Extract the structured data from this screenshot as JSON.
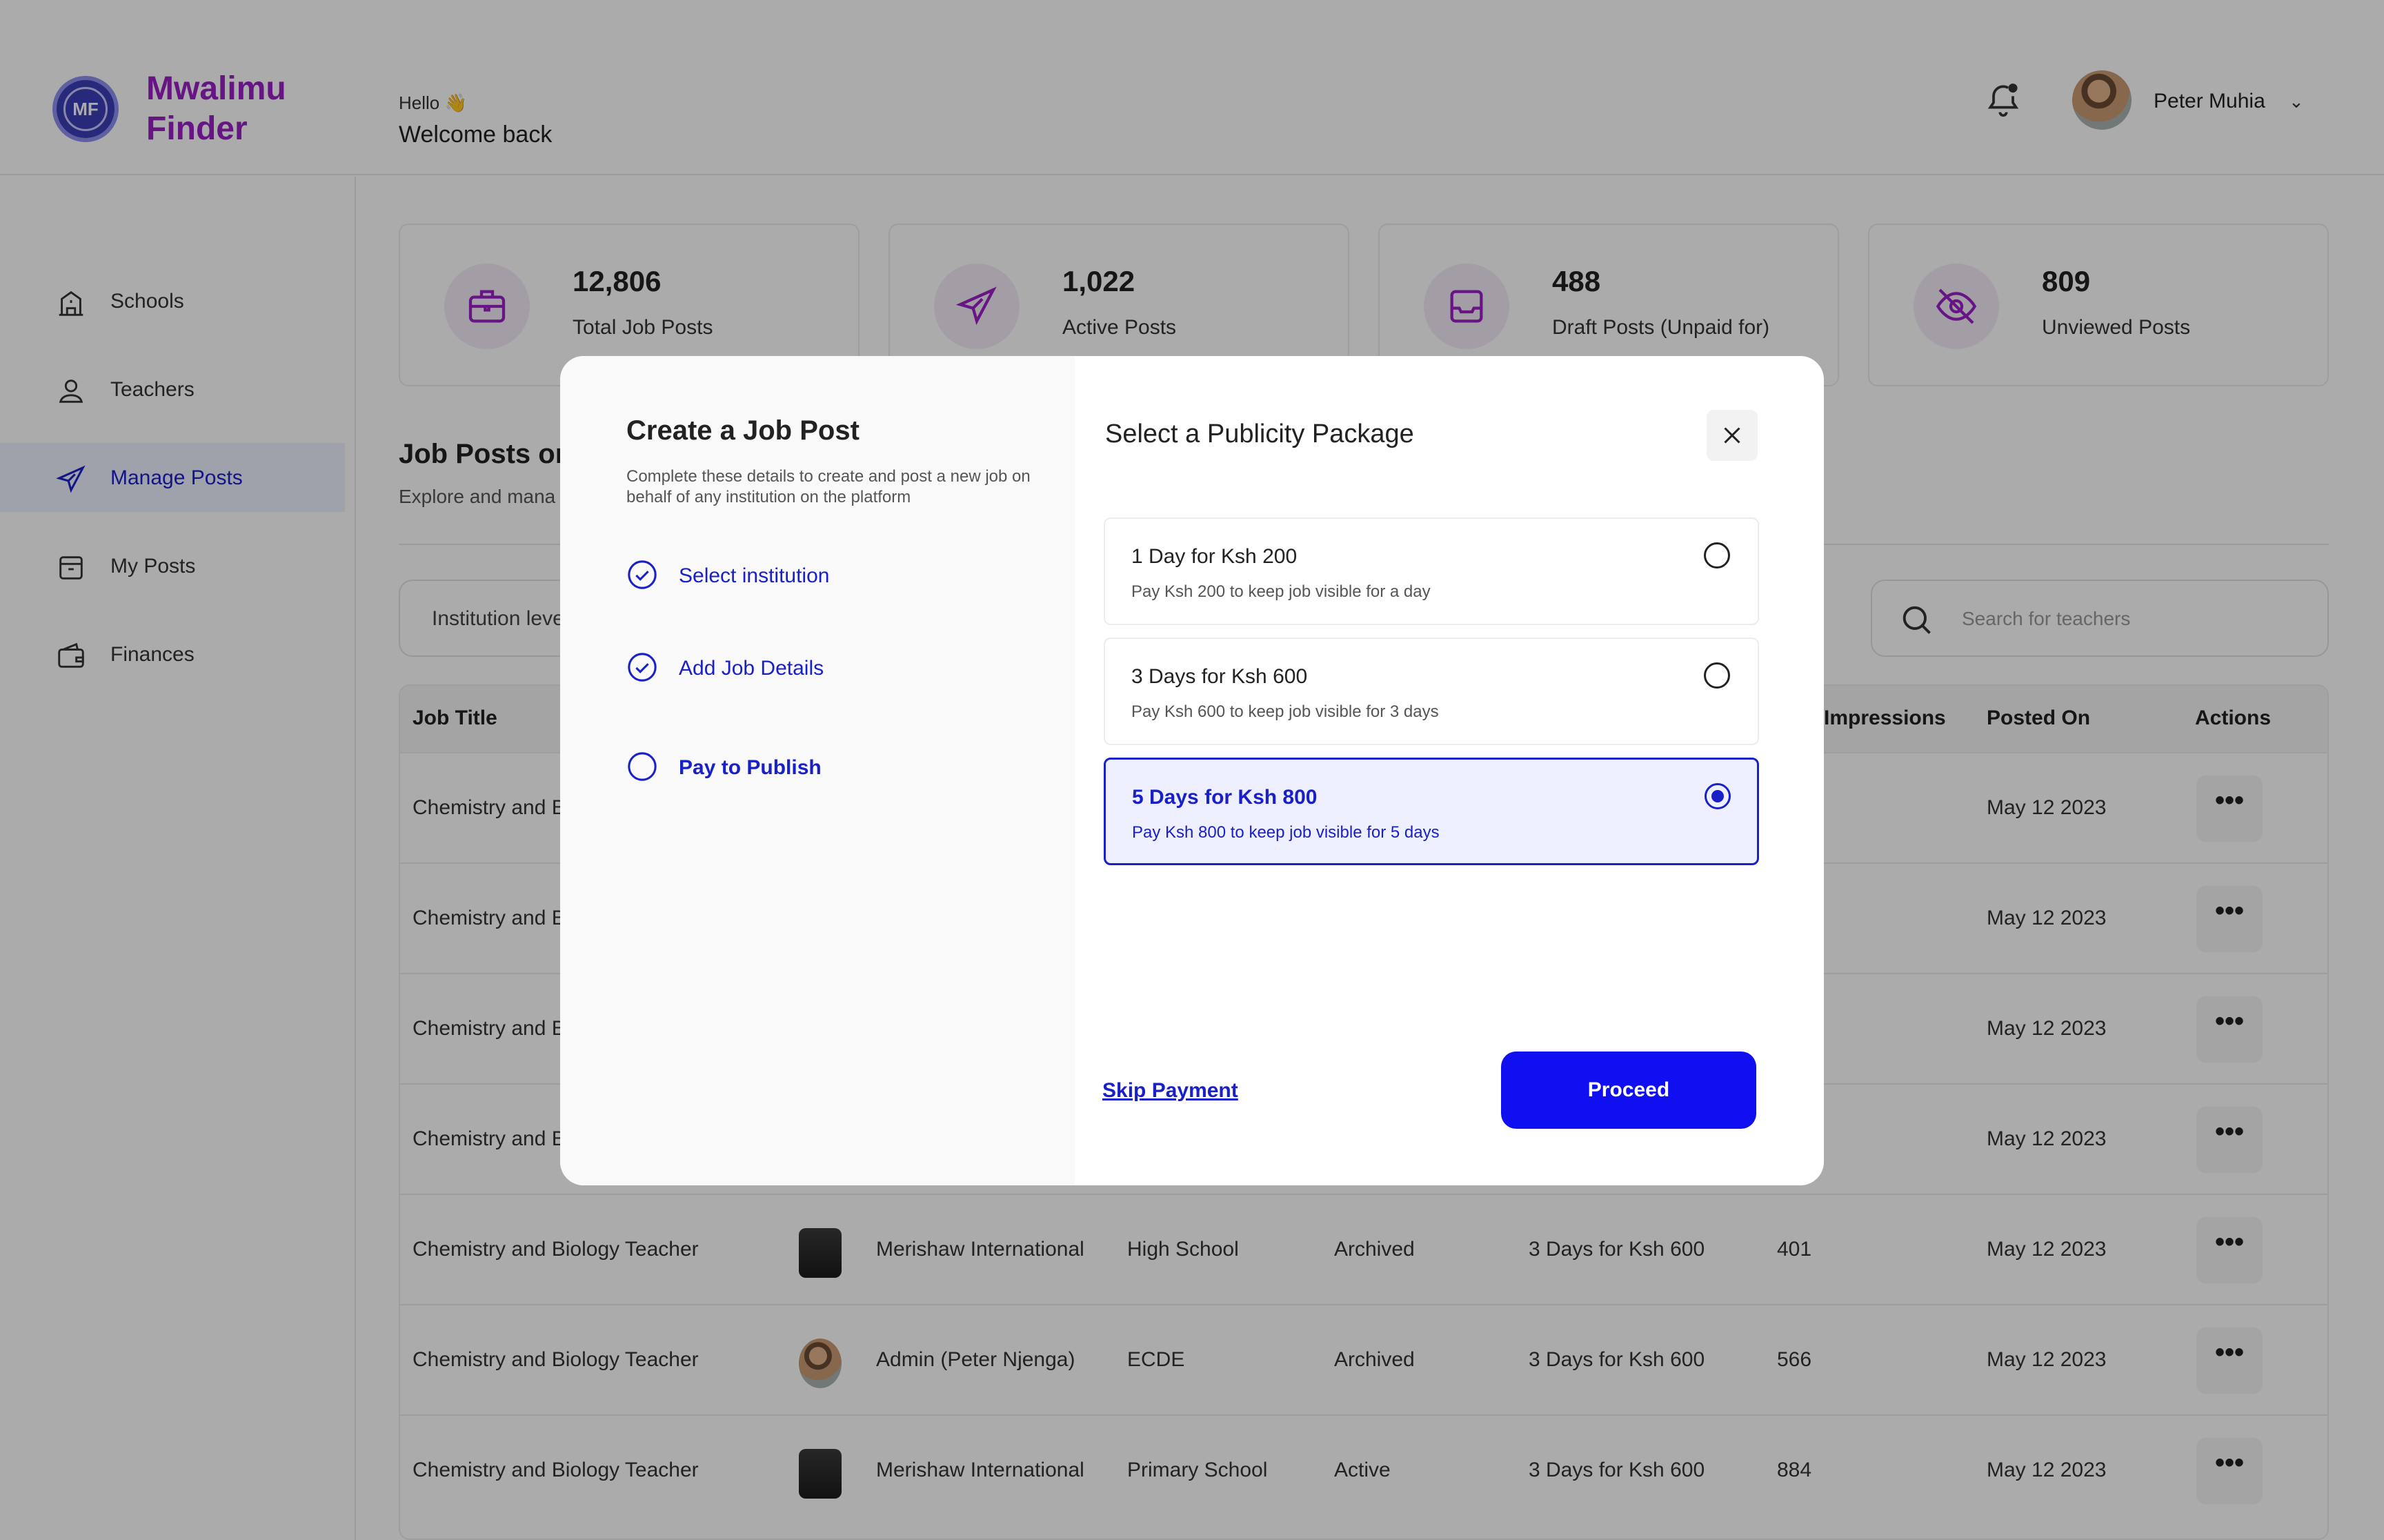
{
  "brand": {
    "name": "Mwalimu Finder",
    "logo_text": "MF"
  },
  "header": {
    "hello": "Hello 👋",
    "welcome": "Welcome back",
    "user_name": "Peter Muhia"
  },
  "sidebar": {
    "items": [
      {
        "label": "Schools",
        "icon": "school-icon"
      },
      {
        "label": "Teachers",
        "icon": "user-icon"
      },
      {
        "label": "Manage Posts",
        "icon": "send-icon",
        "active": true
      },
      {
        "label": "My Posts",
        "icon": "archive-box-icon"
      },
      {
        "label": "Finances",
        "icon": "wallet-icon"
      }
    ]
  },
  "stats": [
    {
      "value": "12,806",
      "label": "Total Job Posts",
      "icon": "briefcase-icon"
    },
    {
      "value": "1,022",
      "label": "Active Posts",
      "icon": "send-icon"
    },
    {
      "value": "488",
      "label": "Draft Posts (Unpaid for)",
      "icon": "inbox-icon"
    },
    {
      "value": "809",
      "label": "Unviewed Posts",
      "icon": "eye-off-icon"
    }
  ],
  "section": {
    "title": "Job Posts on",
    "subtitle": "Explore and mana"
  },
  "filter": {
    "label": "Institution leve"
  },
  "search": {
    "placeholder": "Search for teachers"
  },
  "table": {
    "columns": [
      "Job Title",
      "Impressions",
      "Posted On",
      "Actions"
    ],
    "rows": [
      {
        "title": "Chemistry and B",
        "institution": "",
        "level": "",
        "status": "",
        "package": "",
        "impressions": "",
        "posted": "May 12 2023"
      },
      {
        "title": "Chemistry and B",
        "institution": "",
        "level": "",
        "status": "",
        "package": "",
        "impressions": "",
        "posted": "May 12 2023"
      },
      {
        "title": "Chemistry and B",
        "institution": "",
        "level": "",
        "status": "",
        "package": "",
        "impressions": "",
        "posted": "May 12 2023"
      },
      {
        "title": "Chemistry and B",
        "institution": "",
        "level": "",
        "status": "",
        "package": "",
        "impressions": "",
        "posted": "May 12 2023"
      },
      {
        "title": "Chemistry and Biology Teacher",
        "institution": "Merishaw International",
        "level": "High School",
        "status": "Archived",
        "package": "3 Days for Ksh 600",
        "impressions": "401",
        "posted": "May 12 2023"
      },
      {
        "title": "Chemistry and Biology Teacher",
        "institution": "Admin (Peter Njenga)",
        "level": "ECDE",
        "status": "Archived",
        "package": "3 Days for Ksh 600",
        "impressions": "566",
        "posted": "May 12 2023"
      },
      {
        "title": "Chemistry and Biology Teacher",
        "institution": "Merishaw International",
        "level": "Primary School",
        "status": "Active",
        "package": "3 Days for Ksh 600",
        "impressions": "884",
        "posted": "May 12 2023"
      }
    ],
    "actions_label": "•••"
  },
  "modal": {
    "title": "Create a Job Post",
    "subtitle": "Complete these details to create and post a new job on behalf of any institution on the platform",
    "steps": [
      {
        "label": "Select institution",
        "done": true
      },
      {
        "label": "Add Job Details",
        "done": true
      },
      {
        "label": "Pay to Publish",
        "done": false
      }
    ],
    "right_title": "Select a Publicity Package",
    "packages": [
      {
        "name": "1 Day for Ksh 200",
        "desc": "Pay Ksh 200 to keep job visible for a day",
        "selected": false
      },
      {
        "name": "3 Days for Ksh 600",
        "desc": "Pay Ksh 600 to keep job visible for 3 days",
        "selected": false
      },
      {
        "name": "5 Days for Ksh 800",
        "desc": "Pay Ksh 800 to keep job visible for 5 days",
        "selected": true
      }
    ],
    "skip_label": "Skip Payment",
    "proceed_label": "Proceed"
  },
  "colors": {
    "accent": "#1a20c8",
    "brand": "#9a1ec6",
    "button": "#0f0ff0",
    "overlay": "rgba(0,0,0,0.33)"
  }
}
